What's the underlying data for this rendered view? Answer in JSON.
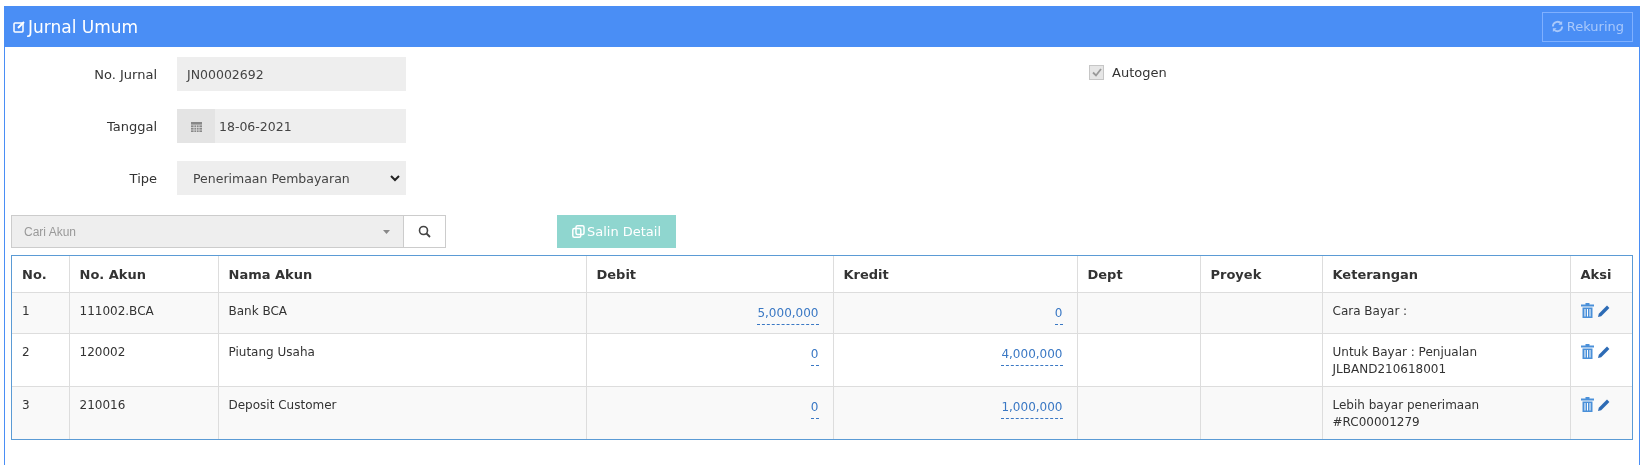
{
  "panel": {
    "title": "Jurnal Umum",
    "recurring_button": {
      "label": "Rekuring",
      "disabled": true
    }
  },
  "form": {
    "journal_no": {
      "label": "No. Jurnal",
      "value": "JN00002692"
    },
    "date": {
      "label": "Tanggal",
      "value": "18-06-2021"
    },
    "type": {
      "label": "Tipe",
      "value": "Penerimaan Pembayaran"
    },
    "autogen": {
      "label": "Autogen",
      "checked": true,
      "disabled": true
    }
  },
  "account_search": {
    "placeholder": "Cari Akun"
  },
  "copy_button": {
    "label": "Salin Detail",
    "disabled": true
  },
  "table": {
    "columns": [
      "No.",
      "No. Akun",
      "Nama Akun",
      "Debit",
      "Kredit",
      "Dept",
      "Proyek",
      "Keterangan",
      "Aksi"
    ],
    "rows": [
      {
        "no": "1",
        "account_no": "111002.BCA",
        "account_name": "Bank BCA",
        "debit": "5,000,000",
        "credit": "0",
        "note": "Cara Bayar :"
      },
      {
        "no": "2",
        "account_no": "120002",
        "account_name": "Piutang Usaha",
        "debit": "0",
        "credit": "4,000,000",
        "note": "Untuk Bayar : Penjualan JLBAND210618001"
      },
      {
        "no": "3",
        "account_no": "210016",
        "account_name": "Deposit Customer",
        "debit": "0",
        "credit": "1,000,000",
        "note": "Lebih bayar penerimaan #RC00001279"
      }
    ]
  }
}
